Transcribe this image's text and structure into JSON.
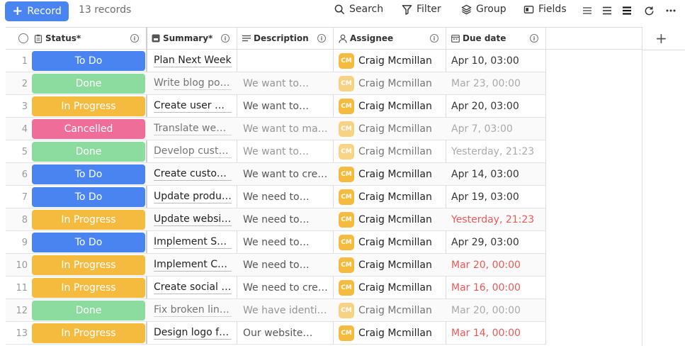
{
  "toolbar": {
    "record_label": "Record",
    "records_count": "13 records",
    "search_label": "Search",
    "filter_label": "Filter",
    "group_label": "Group",
    "fields_label": "Fields"
  },
  "columns": {
    "status": "Status*",
    "summary": "Summary*",
    "description": "Description",
    "assignee": "Assignee",
    "due_date": "Due date"
  },
  "colors": {
    "To Do": "#4a84f0",
    "Done": "#8bdc9e",
    "In Progress": "#f5bb3f",
    "Cancelled": "#ef6d99",
    "avatar": "#f5bb3f",
    "overdue": "#e85a57",
    "accent": "#4a84f0"
  },
  "rows": [
    {
      "num": "1",
      "status": "To Do",
      "summary": "Plan Next Week",
      "description": "",
      "assignee": "Craig Mcmillan",
      "initials": "CM",
      "due": "Apr 10, 03:00",
      "faded": false,
      "overdue": false
    },
    {
      "num": "2",
      "status": "Done",
      "summary": "Write blog post …",
      "description": "We want to…",
      "assignee": "Craig Mcmillan",
      "initials": "CM",
      "due": "Mar 23, 00:00",
      "faded": true,
      "overdue": false
    },
    {
      "num": "3",
      "status": "In Progress",
      "summary": "Create user ma…",
      "description": "We want to…",
      "assignee": "Craig Mcmillan",
      "initials": "CM",
      "due": "Apr 20, 03:00",
      "faded": false,
      "overdue": false
    },
    {
      "num": "4",
      "status": "Cancelled",
      "summary": "Translate websi…",
      "description": "We want to make…",
      "assignee": "Craig Mcmillan",
      "initials": "CM",
      "due": "Apr 7, 03:00",
      "faded": true,
      "overdue": false
    },
    {
      "num": "5",
      "status": "Done",
      "summary": "Develop custo…",
      "description": "We want to…",
      "assignee": "Craig Mcmillan",
      "initials": "CM",
      "due": "Yesterday, 21:23",
      "faded": true,
      "overdue": false
    },
    {
      "num": "6",
      "status": "To Do",
      "summary": "Create custom…",
      "description": "We want to creat…",
      "assignee": "Craig Mcmillan",
      "initials": "CM",
      "due": "Apr 14, 03:00",
      "faded": false,
      "overdue": false
    },
    {
      "num": "7",
      "status": "To Do",
      "summary": "Update produc…",
      "description": "We need to…",
      "assignee": "Craig Mcmillan",
      "initials": "CM",
      "due": "Apr 19, 03:00",
      "faded": false,
      "overdue": false
    },
    {
      "num": "8",
      "status": "In Progress",
      "summary": "Update website…",
      "description": "We need to…",
      "assignee": "Craig Mcmillan",
      "initials": "CM",
      "due": "Yesterday, 21:23",
      "faded": false,
      "overdue": true
    },
    {
      "num": "9",
      "status": "To Do",
      "summary": "Implement SSL …",
      "description": "We need to…",
      "assignee": "Craig Mcmillan",
      "initials": "CM",
      "due": "Apr 29, 03:00",
      "faded": false,
      "overdue": false
    },
    {
      "num": "10",
      "status": "In Progress",
      "summary": "Implement CR…",
      "description": "We need to…",
      "assignee": "Craig Mcmillan",
      "initials": "CM",
      "due": "Mar 20, 00:00",
      "faded": false,
      "overdue": true
    },
    {
      "num": "11",
      "status": "In Progress",
      "summary": "Create social m…",
      "description": "We need to creat…",
      "assignee": "Craig Mcmillan",
      "initials": "CM",
      "due": "Mar 16, 00:00",
      "faded": false,
      "overdue": true
    },
    {
      "num": "12",
      "status": "Done",
      "summary": "Fix broken links…",
      "description": "We have identifie…",
      "assignee": "Craig Mcmillan",
      "initials": "CM",
      "due": "Mar 20, 00:00",
      "faded": true,
      "overdue": false
    },
    {
      "num": "13",
      "status": "In Progress",
      "summary": "Design logo for …",
      "description": "Our website…",
      "assignee": "Craig Mcmillan",
      "initials": "CM",
      "due": "Mar 14, 00:00",
      "faded": false,
      "overdue": true
    }
  ]
}
